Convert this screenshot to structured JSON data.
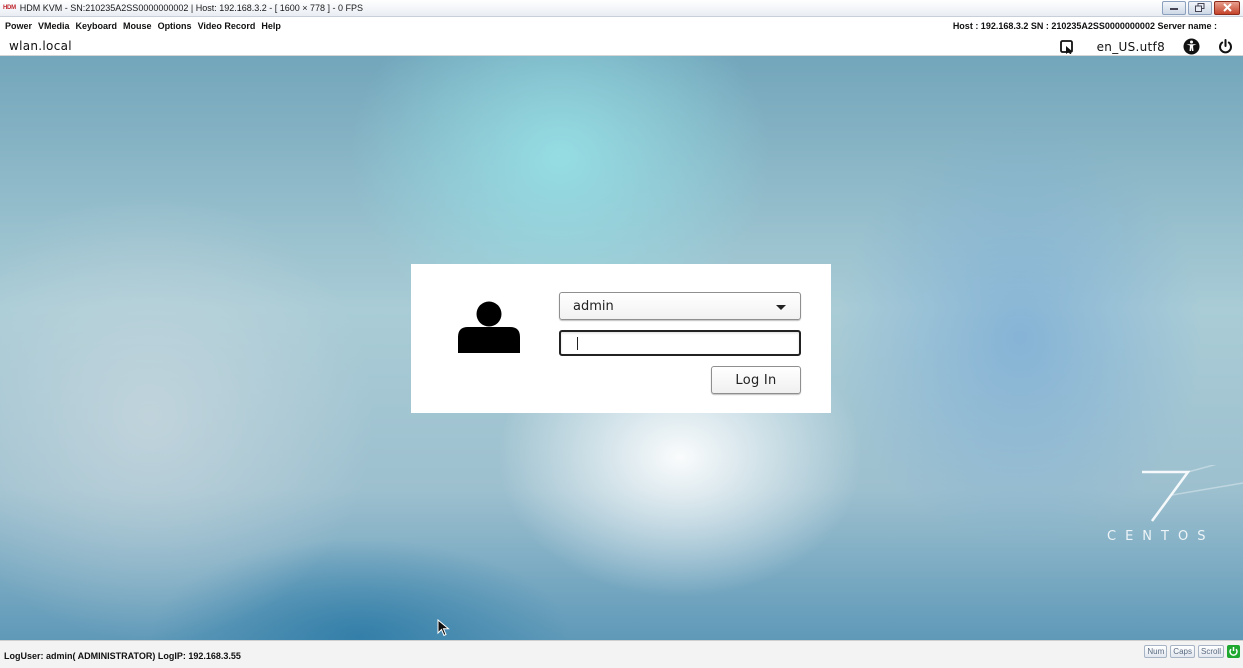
{
  "window": {
    "app_logo": "HDM",
    "title": "HDM KVM - SN:210235A2SS0000000002 | Host: 192.168.3.2 - [ 1600 × 778 ] - 0 FPS",
    "controls": {
      "minimize": "▭",
      "maximize": "🗗",
      "close": "✕"
    }
  },
  "menubar": {
    "items": [
      "Power",
      "VMedia",
      "Keyboard",
      "Mouse",
      "Options",
      "Video Record",
      "Help"
    ],
    "host_info": "Host : 192.168.3.2  SN : 210235A2SS0000000002  Server name :"
  },
  "remote": {
    "topbar": {
      "hostname": "wlan.local",
      "locale": "en_US.utf8",
      "icons": [
        "session-indicator-icon",
        "accessibility-icon",
        "power-icon"
      ]
    },
    "login": {
      "username": "admin",
      "password_value": "",
      "login_button": "Log In"
    },
    "watermark": {
      "number": "7",
      "text": "CENTOS"
    }
  },
  "statusbar": {
    "text": "LogUser: admin( ADMINISTRATOR)    LogIP: 192.168.3.55",
    "indicators": [
      "Num",
      "Caps",
      "Scroll"
    ],
    "connection_color": "#1fa82f"
  },
  "colors": {
    "accent_red": "#c0272d",
    "connection_green": "#1fa82f"
  }
}
